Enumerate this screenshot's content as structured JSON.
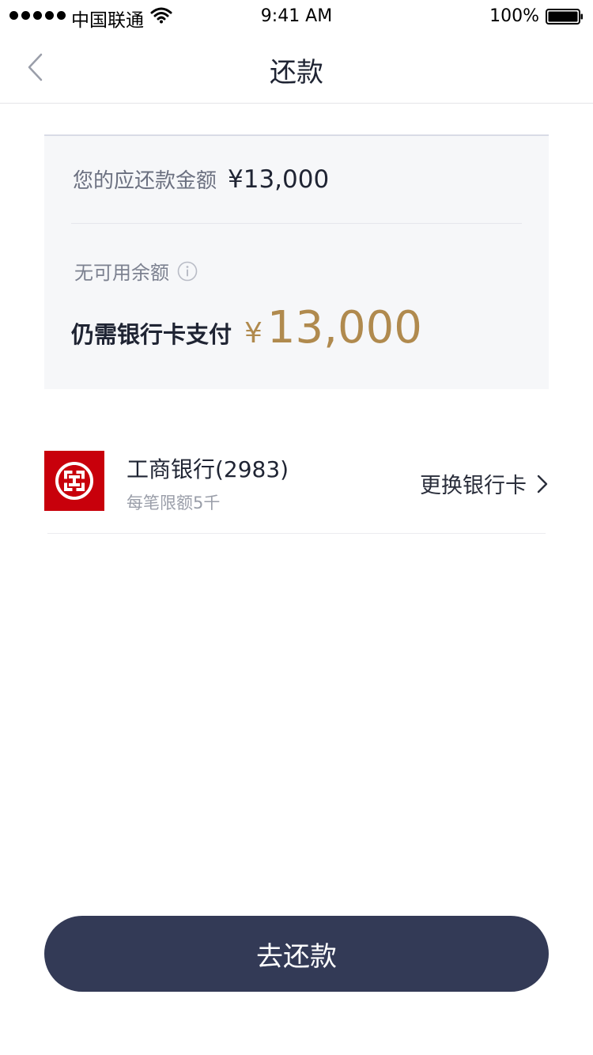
{
  "status_bar": {
    "carrier": "中国联通",
    "time": "9:41 AM",
    "battery": "100%"
  },
  "nav": {
    "title": "还款"
  },
  "summary": {
    "due_label": "您的应还款金额",
    "due_amount": "¥13,000",
    "balance_label": "无可用余额",
    "need_label": "仍需银行卡支付",
    "need_currency": "¥",
    "need_value": "13,000"
  },
  "bank": {
    "name": "工商银行(2983)",
    "limit": "每笔限额5千",
    "change_label": "更换银行卡",
    "logo_color": "#c8000b"
  },
  "actions": {
    "repay_label": "去还款"
  },
  "colors": {
    "accent_gold": "#b08a4e",
    "button_navy": "#333a56",
    "card_bg": "#f6f7f9"
  }
}
